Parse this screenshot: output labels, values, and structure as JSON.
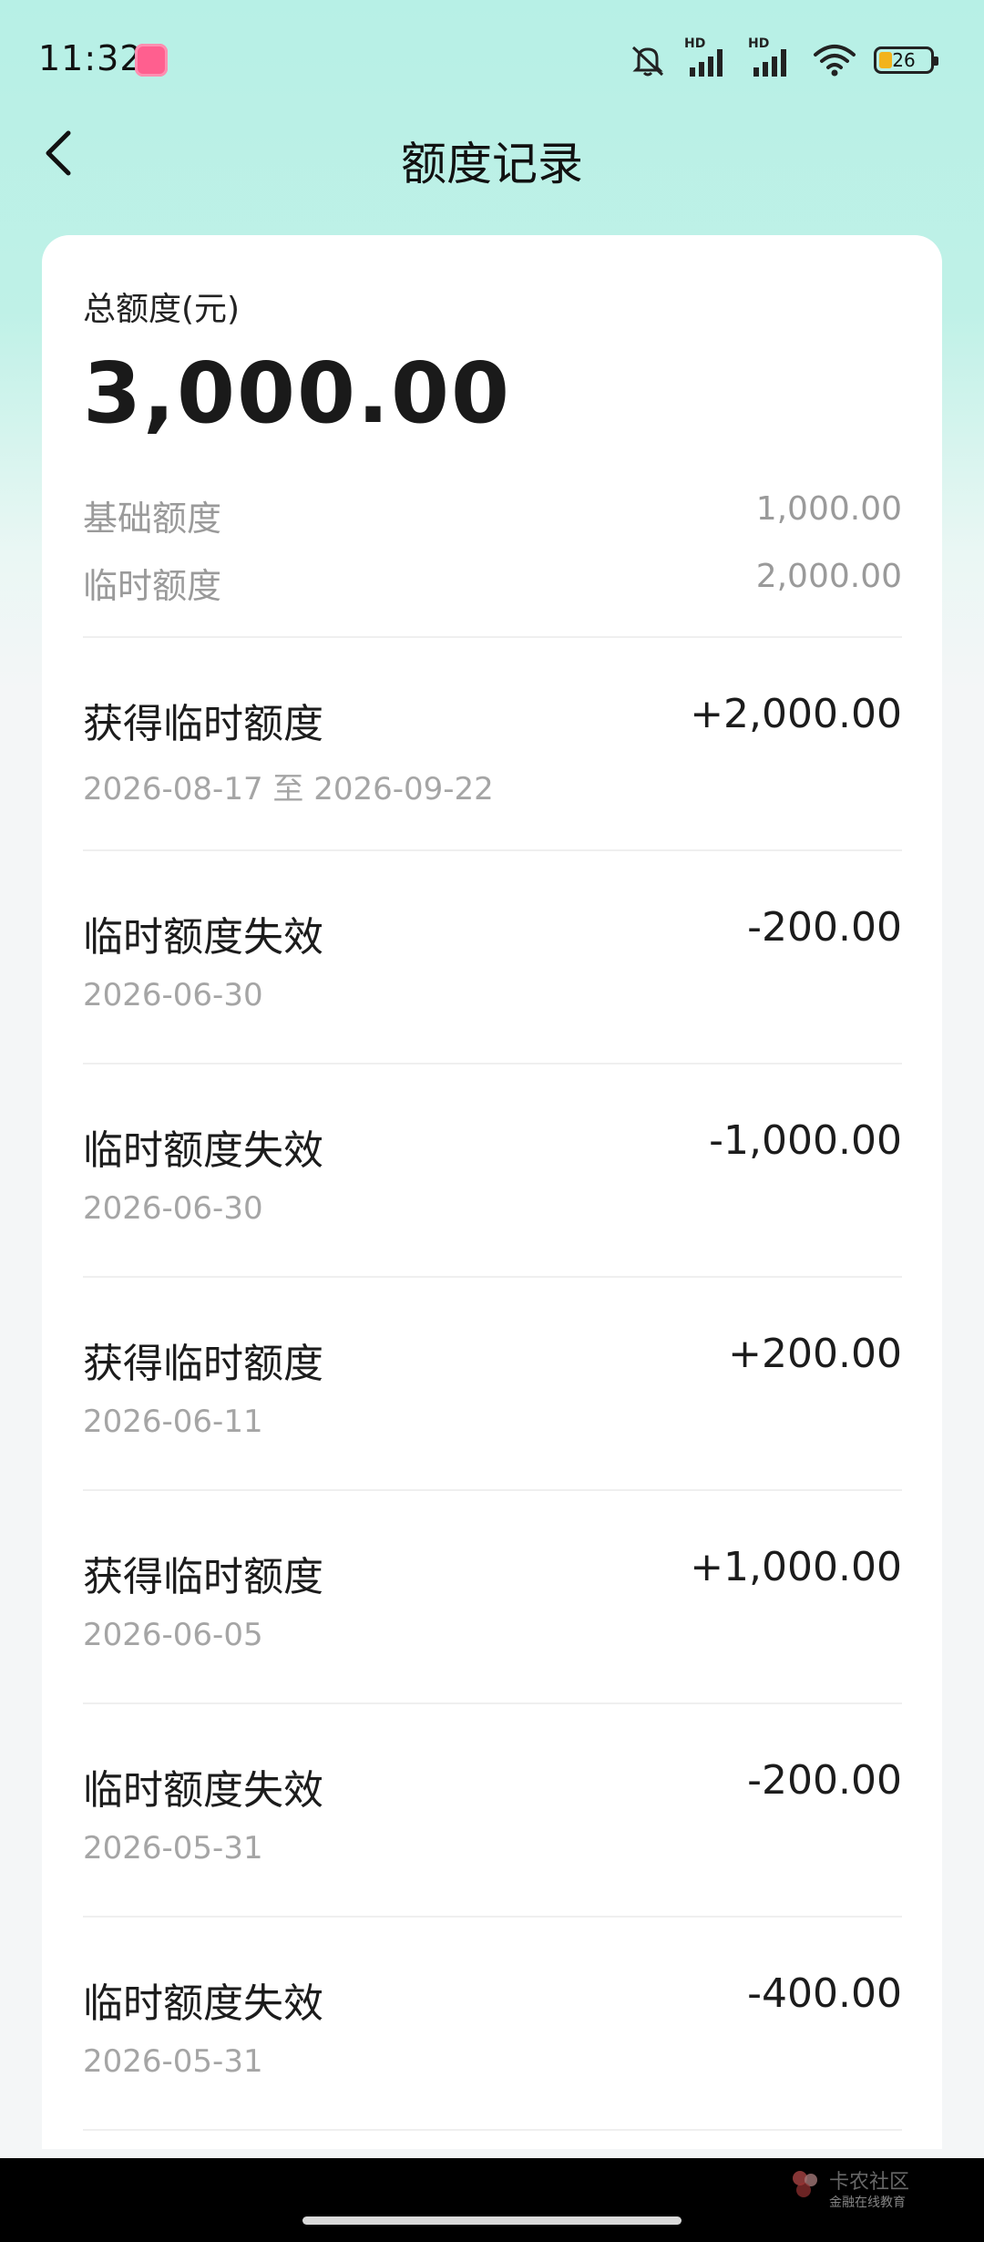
{
  "status_bar": {
    "time": "11:32",
    "battery_level": "26",
    "battery_fraction": 0.26,
    "network_labels": [
      "HD",
      "HD"
    ],
    "icons": [
      "silent-icon",
      "signal-icon",
      "signal-icon",
      "wifi-icon",
      "battery-icon"
    ]
  },
  "header": {
    "title": "额度记录",
    "back_icon": "chevron-left-icon"
  },
  "summary": {
    "total_label": "总额度(元)",
    "total_amount": "3,000.00",
    "basic_label": "基础额度",
    "basic_value": "1,000.00",
    "temp_label": "临时额度",
    "temp_value": "2,000.00"
  },
  "records": [
    {
      "title": "获得临时额度",
      "date": "2026-08-17 至 2026-09-22",
      "amount": "+2,000.00"
    },
    {
      "title": "临时额度失效",
      "date": "2026-06-30",
      "amount": "-200.00"
    },
    {
      "title": "临时额度失效",
      "date": "2026-06-30",
      "amount": "-1,000.00"
    },
    {
      "title": "获得临时额度",
      "date": "2026-06-11",
      "amount": "+200.00"
    },
    {
      "title": "获得临时额度",
      "date": "2026-06-05",
      "amount": "+1,000.00"
    },
    {
      "title": "临时额度失效",
      "date": "2026-05-31",
      "amount": "-200.00"
    },
    {
      "title": "临时额度失效",
      "date": "2026-05-31",
      "amount": "-400.00"
    }
  ],
  "watermark": {
    "name": "卡农社区",
    "tagline": "金融在线教育"
  },
  "colors": {
    "header_bg": "#b7f0e6",
    "page_bg": "#f4f6f7",
    "card_bg": "#ffffff",
    "muted_text": "#9a9a9a"
  }
}
